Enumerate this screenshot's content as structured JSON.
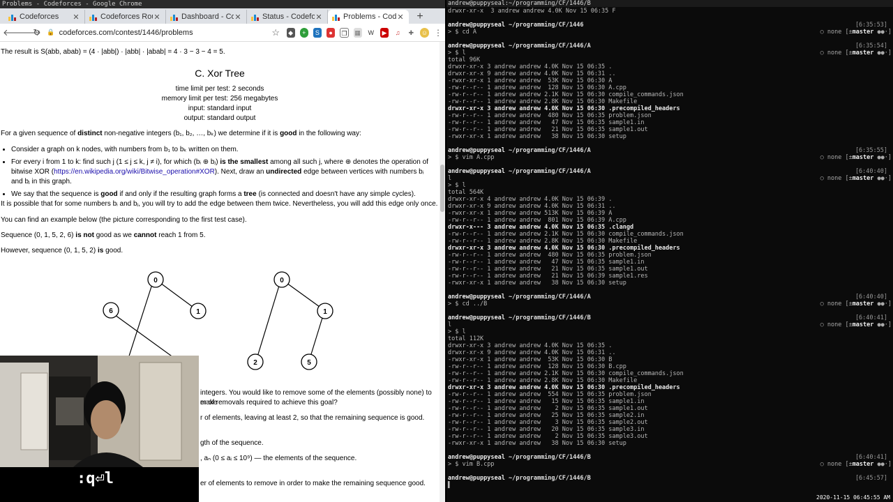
{
  "window": {
    "title": "Problems - Codeforces - Google Chrome"
  },
  "tabs": [
    {
      "label": "Codeforces",
      "active": false
    },
    {
      "label": "Codeforces Rou",
      "active": false
    },
    {
      "label": "Dashboard - Co",
      "active": false
    },
    {
      "label": "Status - Codefo",
      "active": false
    },
    {
      "label": "Problems - Cod",
      "active": true
    }
  ],
  "toolbar": {
    "url": "codeforces.com/contest/1446/problems",
    "back_icon": "arrow-left-icon",
    "forward_icon": "arrow-right-icon",
    "reload_icon": "reload-icon"
  },
  "problem": {
    "result_line": "The result is S(abb, abab) = (4 · |abb|) · |abb| · |abab| = 4 · 3 − 3 − 4 = 5.",
    "title": "C. Xor Tree",
    "time_limit": "time limit per test: 2 seconds",
    "memory_limit": "memory limit per test: 256 megabytes",
    "input": "input: standard input",
    "output": "output: standard output",
    "intro_1": "For a given sequence of",
    "intro_bold": "distinct",
    "intro_2": "non-negative integers (b₁, b₂, …, bₖ) we determine if it is",
    "intro_good": "good",
    "intro_3": "in the following way:",
    "bullet_1": "Consider a graph on k nodes, with numbers from b₁ to bₖ written on them.",
    "bullet_2a": "For every i from 1 to k: find such j (1 ≤ j ≤ k, j ≠ i), for which (bᵢ ⊕ bⱼ)",
    "bullet_2b": "is the smallest",
    "bullet_2c": "among all such j, where ⊕ denotes the operation of bitwise XOR (",
    "bullet_2_link": "https://en.wikipedia.org/wiki/Bitwise_operation#XOR",
    "bullet_2d": "). Next, draw an",
    "bullet_2e": "undirected",
    "bullet_2f": "edge between vertices with numbers bᵢ and bⱼ in this graph.",
    "bullet_3a": "We say that the sequence is",
    "bullet_3b": "good",
    "bullet_3c": "if and only if the resulting graph forms a",
    "bullet_3d": "tree",
    "bullet_3e": "(is connected and doesn't have any simple cycles).",
    "para_twice": "It is possible that for some numbers bᵢ and bⱼ, you will try to add the edge between them twice. Nevertheless, you will add this edge only once.",
    "para_example": "You can find an example below (the picture corresponding to the first test case).",
    "seq_bad_a": "Sequence (0, 1, 5, 2, 6)",
    "seq_bad_b": "is not",
    "seq_bad_c": "good as we",
    "seq_bad_d": "cannot",
    "seq_bad_e": "reach 1 from 5.",
    "seq_good_a": "However, sequence (0, 1, 5, 2)",
    "seq_good_b": "is",
    "seq_good_c": "good.",
    "graph_left": [
      "0",
      "6",
      "1"
    ],
    "graph_right": [
      "0",
      "1",
      "2",
      "5"
    ],
    "frag_1": "integers. You would like to remove some of the elements (possibly none) to make",
    "frag_2": "er of removals required to achieve this goal?",
    "frag_3": "r of elements, leaving at least 2, so that the remaining sequence is good.",
    "frag_4": "gth of the sequence.",
    "frag_5": ", aₙ (0 ≤ aᵢ ≤ 10⁹) — the elements of the sequence.",
    "frag_6": "er of elements to remove in order to make the remaining sequence good."
  },
  "webcam": {
    "keys": ":q⏎l"
  },
  "terminal": {
    "title": "andrew@puppyseal:~/programming/CF/1446/B",
    "lines": [
      {
        "t": "drwxr-xr-x  3 andrew andrew 4.0K Nov 15 06:35 F"
      },
      {
        "t": ""
      },
      {
        "prompt": true,
        "user": "andrew@puppyseal",
        "path": "~/programming/CF/1446",
        "time": "[6:35:53]",
        "status": "none",
        "branch": "master"
      },
      {
        "t": "> $ cd A"
      },
      {
        "t": ""
      },
      {
        "prompt": true,
        "user": "andrew@puppyseal",
        "path": "~/programming/CF/1446/A",
        "time": "[6:35:54]",
        "status": "none",
        "branch": "master"
      },
      {
        "t": "> $ l"
      },
      {
        "t": "total 96K"
      },
      {
        "t": "drwxr-xr-x 3 andrew andrew 4.0K Nov 15 06:35 ."
      },
      {
        "t": "drwxr-xr-x 9 andrew andrew 4.0K Nov 15 06:31 .."
      },
      {
        "t": "-rwxr-xr-x 1 andrew andrew  53K Nov 15 06:30 A"
      },
      {
        "t": "-rw-r--r-- 1 andrew andrew  128 Nov 15 06:30 A.cpp"
      },
      {
        "t": "-rw-r--r-- 1 andrew andrew 2.1K Nov 15 06:30 compile_commands.json"
      },
      {
        "t": "-rw-r--r-- 1 andrew andrew 2.8K Nov 15 06:30 Makefile"
      },
      {
        "t": "drwxr-xr-x 3 andrew andrew 4.0K Nov 15 06:30 .precompiled_headers",
        "bold": true
      },
      {
        "t": "-rw-r--r-- 1 andrew andrew  480 Nov 15 06:35 problem.json"
      },
      {
        "t": "-rw-r--r-- 1 andrew andrew   47 Nov 15 06:35 sample1.in"
      },
      {
        "t": "-rw-r--r-- 1 andrew andrew   21 Nov 15 06:35 sample1.out"
      },
      {
        "t": "-rwxr-xr-x 1 andrew andrew   38 Nov 15 06:30 setup"
      },
      {
        "t": ""
      },
      {
        "prompt": true,
        "user": "andrew@puppyseal",
        "path": "~/programming/CF/1446/A",
        "time": "[6:35:55]",
        "status": "none",
        "branch": "master"
      },
      {
        "t": "> $ vim A.cpp"
      },
      {
        "t": ""
      },
      {
        "prompt": true,
        "user": "andrew@puppyseal",
        "path": "~/programming/CF/1446/A",
        "time": "[6:40:40]",
        "status": "none",
        "branch": "master"
      },
      {
        "t": "l"
      },
      {
        "t": "> $ l"
      },
      {
        "t": "total 564K"
      },
      {
        "t": "drwxr-xr-x 4 andrew andrew 4.0K Nov 15 06:39 ."
      },
      {
        "t": "drwxr-xr-x 9 andrew andrew 4.0K Nov 15 06:31 .."
      },
      {
        "t": "-rwxr-xr-x 1 andrew andrew 513K Nov 15 06:39 A"
      },
      {
        "t": "-rw-r--r-- 1 andrew andrew  801 Nov 15 06:39 A.cpp"
      },
      {
        "t": "drwxr-x--- 3 andrew andrew 4.0K Nov 15 06:35 .clangd",
        "bold": true
      },
      {
        "t": "-rw-r--r-- 1 andrew andrew 2.1K Nov 15 06:30 compile_commands.json"
      },
      {
        "t": "-rw-r--r-- 1 andrew andrew 2.8K Nov 15 06:30 Makefile"
      },
      {
        "t": "drwxr-xr-x 3 andrew andrew 4.0K Nov 15 06:30 .precompiled_headers",
        "bold": true
      },
      {
        "t": "-rw-r--r-- 1 andrew andrew  480 Nov 15 06:35 problem.json"
      },
      {
        "t": "-rw-r--r-- 1 andrew andrew   47 Nov 15 06:35 sample1.in"
      },
      {
        "t": "-rw-r--r-- 1 andrew andrew   21 Nov 15 06:35 sample1.out"
      },
      {
        "t": "-rw-r--r-- 1 andrew andrew   21 Nov 15 06:39 sample1.res"
      },
      {
        "t": "-rwxr-xr-x 1 andrew andrew   38 Nov 15 06:30 setup"
      },
      {
        "t": ""
      },
      {
        "prompt": true,
        "user": "andrew@puppyseal",
        "path": "~/programming/CF/1446/A",
        "time": "[6:40:40]",
        "status": "none",
        "branch": "master"
      },
      {
        "t": "> $ cd ../B"
      },
      {
        "t": ""
      },
      {
        "prompt": true,
        "user": "andrew@puppyseal",
        "path": "~/programming/CF/1446/B",
        "time": "[6:40:41]",
        "status": "none",
        "branch": "master"
      },
      {
        "t": "l"
      },
      {
        "t": "> $ l"
      },
      {
        "t": "total 112K"
      },
      {
        "t": "drwxr-xr-x 3 andrew andrew 4.0K Nov 15 06:35 ."
      },
      {
        "t": "drwxr-xr-x 9 andrew andrew 4.0K Nov 15 06:31 .."
      },
      {
        "t": "-rwxr-xr-x 1 andrew andrew  53K Nov 15 06:30 B"
      },
      {
        "t": "-rw-r--r-- 1 andrew andrew  128 Nov 15 06:30 B.cpp"
      },
      {
        "t": "-rw-r--r-- 1 andrew andrew 2.1K Nov 15 06:30 compile_commands.json"
      },
      {
        "t": "-rw-r--r-- 1 andrew andrew 2.8K Nov 15 06:30 Makefile"
      },
      {
        "t": "drwxr-xr-x 3 andrew andrew 4.0K Nov 15 06:30 .precompiled_headers",
        "bold": true
      },
      {
        "t": "-rw-r--r-- 1 andrew andrew  554 Nov 15 06:35 problem.json"
      },
      {
        "t": "-rw-r--r-- 1 andrew andrew   15 Nov 15 06:35 sample1.in"
      },
      {
        "t": "-rw-r--r-- 1 andrew andrew    2 Nov 15 06:35 sample1.out"
      },
      {
        "t": "-rw-r--r-- 1 andrew andrew   25 Nov 15 06:35 sample2.in"
      },
      {
        "t": "-rw-r--r-- 1 andrew andrew    3 Nov 15 06:35 sample2.out"
      },
      {
        "t": "-rw-r--r-- 1 andrew andrew   20 Nov 15 06:35 sample3.in"
      },
      {
        "t": "-rw-r--r-- 1 andrew andrew    2 Nov 15 06:35 sample3.out"
      },
      {
        "t": "-rwxr-xr-x 1 andrew andrew   38 Nov 15 06:30 setup"
      },
      {
        "t": ""
      },
      {
        "prompt": true,
        "user": "andrew@puppyseal",
        "path": "~/programming/CF/1446/B",
        "time": "[6:40:41]",
        "status": "none",
        "branch": "master"
      },
      {
        "t": "> $ vim B.cpp"
      },
      {
        "t": ""
      },
      {
        "prompt": true,
        "user": "andrew@puppyseal",
        "path": "~/programming/CF/1446/B",
        "time": "[6:45:57]",
        "status": "",
        "branch": ""
      },
      {
        "t": "▌"
      }
    ],
    "clock": "2020-11-15 06:45:55 AM"
  },
  "colors": {
    "tab_strip": "#dee1e6",
    "link": "#1a0dab",
    "terminal_bg": "#0b0b0b"
  }
}
